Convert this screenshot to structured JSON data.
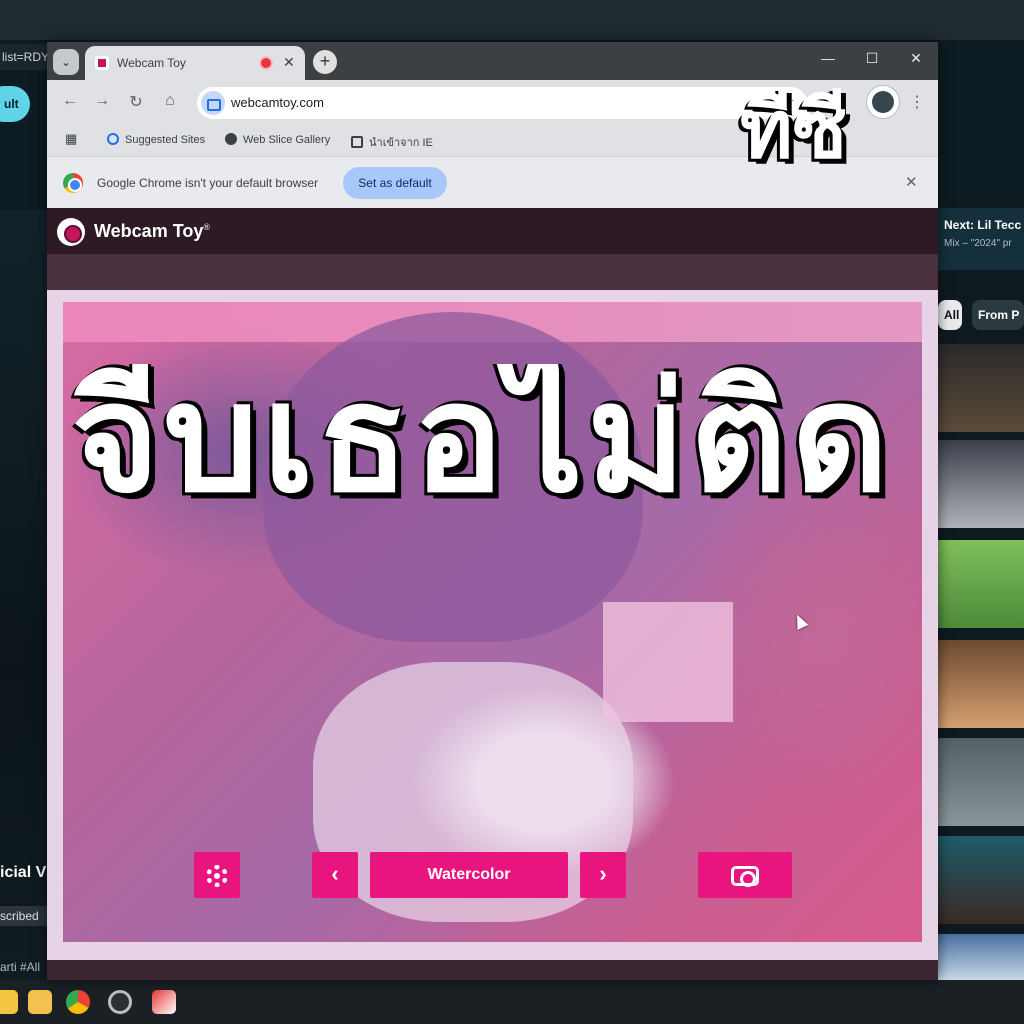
{
  "background": {
    "url_fragment": "list=RDY",
    "button_label": "ult",
    "left_title": "icial V",
    "left_subscribed": "scribed",
    "left_hashtag": "arti #All",
    "next_title": "Next: Lil Tecc",
    "next_sub": "Mix – \"2024\" pr",
    "chip_all": "All",
    "chip_from": "From P"
  },
  "browser": {
    "tab_title": "Webcam Toy",
    "url": "webcamtoy.com",
    "bookmarks": [
      "Suggested Sites",
      "Web Slice Gallery",
      "นำเข้าจาก IE"
    ],
    "infobar_text": "Google Chrome isn't your default browser",
    "set_default_label": "Set as default",
    "icons": {
      "tab_search": "chevron-down-icon",
      "close": "close-icon",
      "new_tab": "plus-icon",
      "back": "arrow-left-icon",
      "forward": "arrow-right-icon",
      "reload": "reload-icon",
      "home": "home-icon",
      "star": "star-icon",
      "extensions": "puzzle-icon",
      "menu": "kebab-icon",
      "minimize": "minimize-icon",
      "maximize": "maximize-icon"
    }
  },
  "app": {
    "title": "Webcam Toy",
    "trademark": "®",
    "effect_name": "Watercolor",
    "accent_color": "#e8157f",
    "overlay_main": "จีบเธอไม่ติด",
    "overlay_small": "ทีซี"
  },
  "glyphs": {
    "close": "✕",
    "plus": "+",
    "chevron_down": "⌄",
    "back": "←",
    "forward": "→",
    "reload": "↻",
    "home": "⌂",
    "star": "☆",
    "menu": "⋮",
    "minimize": "—",
    "maximize": "☐",
    "prev": "‹",
    "next": "›",
    "grid": "▦",
    "search": "⚲"
  }
}
